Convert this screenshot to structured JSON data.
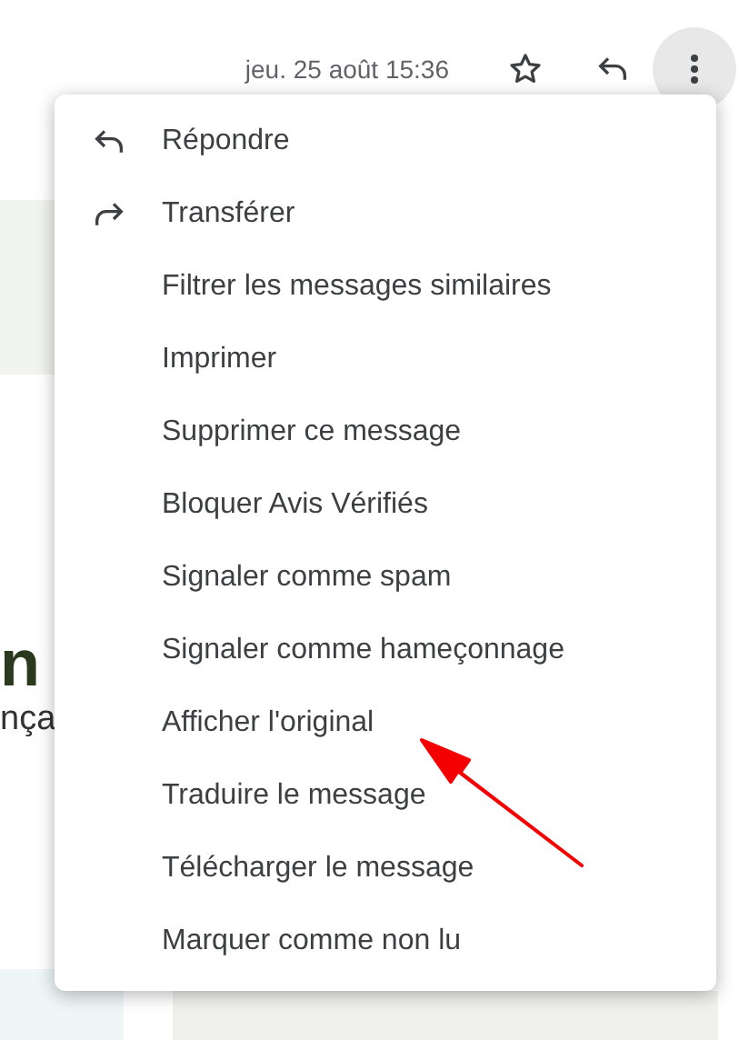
{
  "header": {
    "date": "jeu. 25 août 15:36",
    "more_button": {
      "selected": true
    }
  },
  "background_fragments": [
    "n",
    "nça"
  ],
  "menu": {
    "items": [
      {
        "label": "Répondre",
        "kind": "reply"
      },
      {
        "label": "Transférer",
        "kind": "forward"
      },
      {
        "label": "Filtrer les messages similaires",
        "kind": "plain"
      },
      {
        "label": "Imprimer",
        "kind": "plain"
      },
      {
        "label": "Supprimer ce message",
        "kind": "plain"
      },
      {
        "label": "Bloquer Avis Vérifiés",
        "kind": "plain"
      },
      {
        "label": "Signaler comme spam",
        "kind": "plain"
      },
      {
        "label": "Signaler comme hameçonnage",
        "kind": "plain"
      },
      {
        "label": "Afficher l'original",
        "kind": "plain"
      },
      {
        "label": "Traduire le message",
        "kind": "plain"
      },
      {
        "label": "Télécharger le message",
        "kind": "plain"
      },
      {
        "label": "Marquer comme non lu",
        "kind": "plain"
      }
    ]
  }
}
